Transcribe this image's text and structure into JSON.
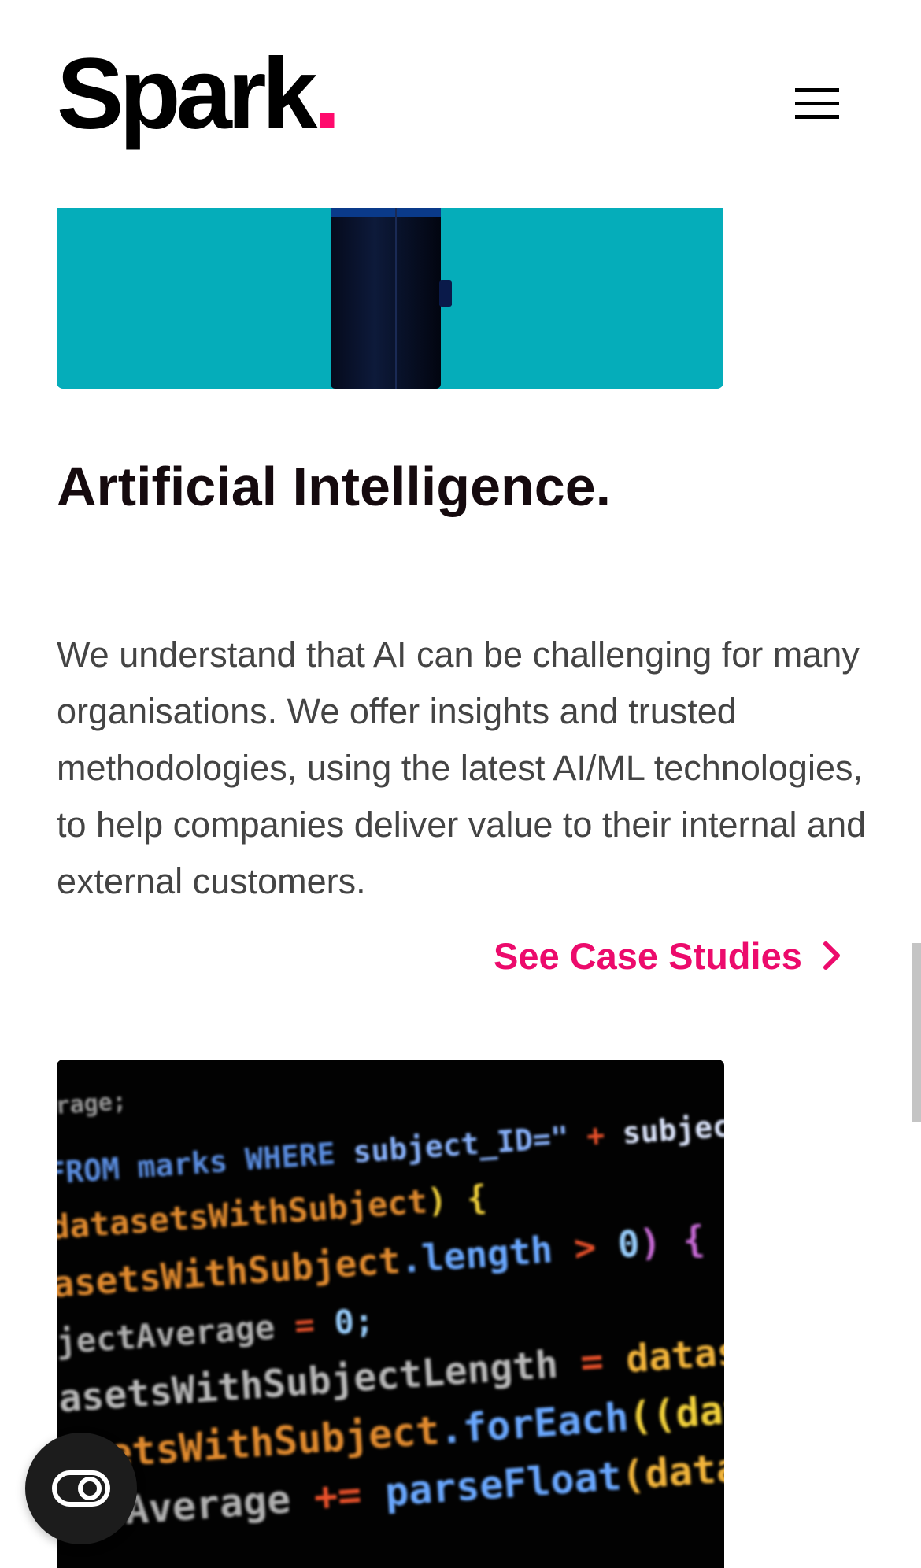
{
  "header": {
    "logo_text": "Spark",
    "logo_dot": ".",
    "menu_icon": "hamburger-menu-icon"
  },
  "colors": {
    "brand_accent": "#ec0b6c",
    "hero_teal": "#05adba",
    "heading": "#150a0e",
    "body_text": "#444444"
  },
  "section": {
    "title": "Artificial Intelligence.",
    "body": "We understand that AI can be challenging for many organisations. We offer insights and trusted methodologies, using the latest AI/ML technologies, to help companies deliver value to their internal and external customers.",
    "link_label": "See Case Studies",
    "link_icon": "chevron-right-icon"
  },
  "code_image": {
    "lines": [
      {
        "segments": [
          {
            "text": "erage;",
            "color": "#9a9a9a"
          }
        ]
      },
      {
        "segments": [
          {
            "text": "FROM marks WHERE ",
            "color": "#5a8de0"
          },
          {
            "text": "subject_ID=\"",
            "color": "#8ab4ff"
          },
          {
            "text": " + ",
            "color": "#e8502a"
          },
          {
            "text": "subjec",
            "color": "#dfe8ff"
          }
        ]
      },
      {
        "segments": [
          {
            "text": "datasetsWithSubject",
            "color": "#e08a2e"
          },
          {
            "text": ") {",
            "color": "#f2d13a"
          }
        ]
      },
      {
        "segments": [
          {
            "text": "asetsWithSubject",
            "color": "#e08a2e"
          },
          {
            "text": ".length ",
            "color": "#6aa8ff"
          },
          {
            "text": "> ",
            "color": "#e8502a"
          },
          {
            "text": "0",
            "color": "#9ad0ff"
          },
          {
            "text": ") {",
            "color": "#c86ad6"
          }
        ]
      },
      {
        "segments": [
          {
            "text": "jectAverage ",
            "color": "#b0b0b0"
          },
          {
            "text": "= ",
            "color": "#e8502a"
          },
          {
            "text": "0;",
            "color": "#9ad0ff"
          }
        ]
      },
      {
        "segments": [
          {
            "text": "asetsWithSubjectLength ",
            "color": "#b8b8b8"
          },
          {
            "text": "= ",
            "color": "#e8502a"
          },
          {
            "text": "datasetsWith",
            "color": "#f2b43a"
          }
        ]
      },
      {
        "segments": [
          {
            "text": "asetsWithSubject",
            "color": "#e08a2e"
          },
          {
            "text": ".forEach",
            "color": "#6aa8ff"
          },
          {
            "text": "((dataset) ",
            "color": "#f2d13a"
          },
          {
            "text": "=>",
            "color": "#e8502a"
          }
        ]
      },
      {
        "segments": [
          {
            "text": "tAverage ",
            "color": "#b0b0b0"
          },
          {
            "text": "+= ",
            "color": "#e8502a"
          },
          {
            "text": "parseFloat",
            "color": "#6aa8ff"
          },
          {
            "text": "(dataset",
            "color": "#f2b43a"
          }
        ]
      }
    ]
  },
  "float_button": {
    "icon": "accessibility-toggle-icon"
  }
}
